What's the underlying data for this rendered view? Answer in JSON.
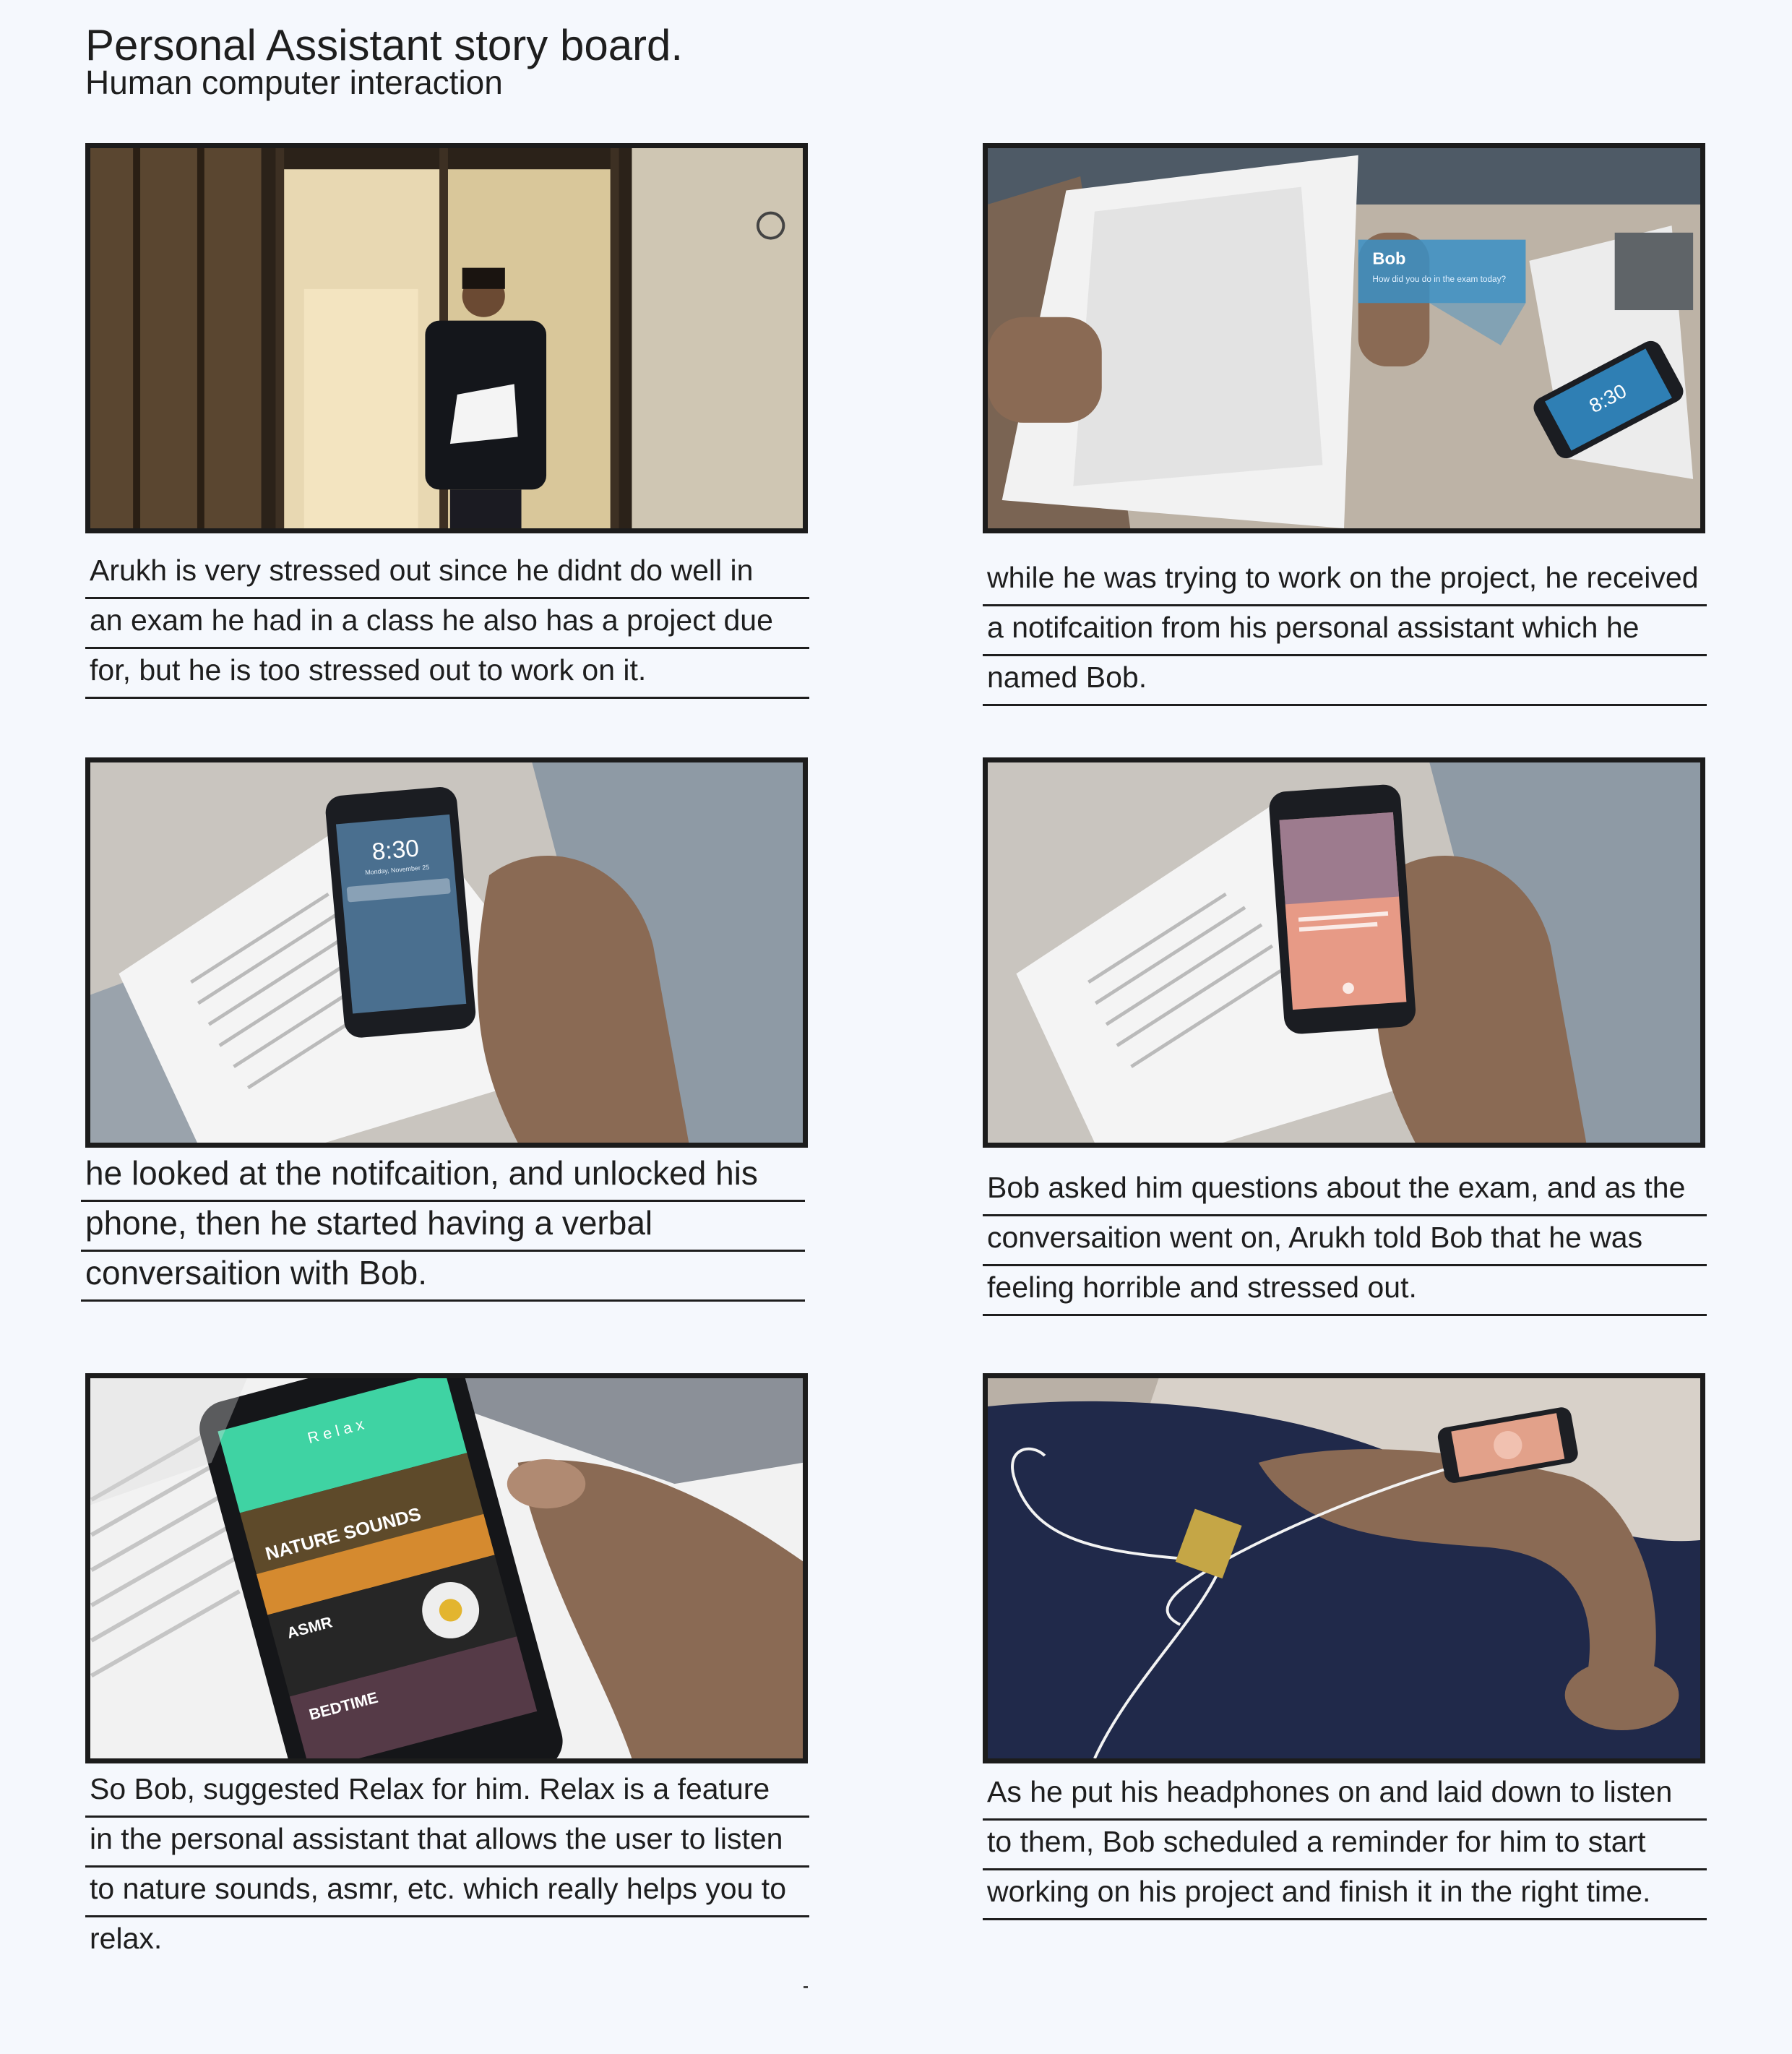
{
  "header": {
    "title": "Personal Assistant story board.",
    "subtitle": "Human computer interaction"
  },
  "panels": [
    {
      "lines": [
        "Arukh is very stressed out since he didnt do well in",
        "an exam he had in a class he also has a project due",
        "for, but he is too stressed out to work on it."
      ]
    },
    {
      "notification_title": "Bob",
      "notification_text": "How did you do in the exam today?",
      "phone_time": "8:30",
      "lines": [
        "while he was trying to work on the project, he received",
        "a notifcaition from his personal assistant which he",
        "named Bob."
      ]
    },
    {
      "phone_time": "8:30",
      "phone_date": "Monday, November 25",
      "lines": [
        "he looked at the notifcaition, and unlocked his",
        "phone, then he started having a verbal",
        "conversaition with Bob."
      ]
    },
    {
      "lines": [
        "Bob asked him questions about the exam, and as the",
        "conversaition went on, Arukh told Bob that he was",
        "feeling horrible and stressed out."
      ]
    },
    {
      "app_title": "R e l a x",
      "app_items": [
        "NATURE SOUNDS",
        "ASMR",
        "BEDTIME"
      ],
      "lines": [
        "So Bob, suggested Relax for him. Relax is a feature",
        "in the personal assistant that allows the user to listen",
        "to nature sounds, asmr, etc. which really helps you to",
        "relax."
      ]
    },
    {
      "lines": [
        "As he put his headphones on and laid down to listen",
        "to them, Bob scheduled a reminder for him to start",
        "working on his project and finish it in the right time."
      ]
    }
  ]
}
